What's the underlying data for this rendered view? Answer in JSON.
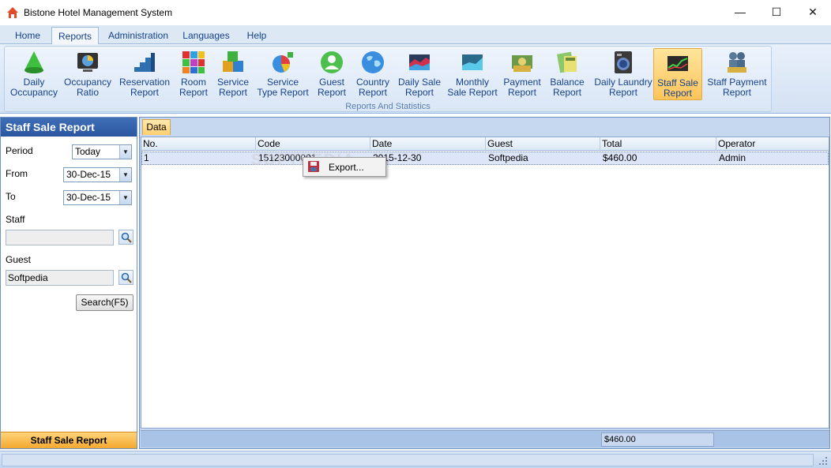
{
  "window": {
    "title": "Bistone Hotel Management System",
    "minimize": "—",
    "maximize": "☐",
    "close": "✕"
  },
  "menu": {
    "tabs": [
      "Home",
      "Reports",
      "Administration",
      "Languages",
      "Help"
    ],
    "active": "Reports"
  },
  "ribbon": {
    "group_label": "Reports And Statistics",
    "buttons": [
      {
        "line1": "Daily",
        "line2": "Occupancy",
        "icon": "cone-icon"
      },
      {
        "line1": "Occupancy",
        "line2": "Ratio",
        "icon": "pie-monitor-icon"
      },
      {
        "line1": "Reservation",
        "line2": "Report",
        "icon": "stairs-icon"
      },
      {
        "line1": "Room",
        "line2": "Report",
        "icon": "cubes-icon"
      },
      {
        "line1": "Service",
        "line2": "Report",
        "icon": "boxes-icon"
      },
      {
        "line1": "Service",
        "line2": "Type Report",
        "icon": "pie-stack-icon"
      },
      {
        "line1": "Guest",
        "line2": "Report",
        "icon": "guest-icon"
      },
      {
        "line1": "Country",
        "line2": "Report",
        "icon": "globe-icon"
      },
      {
        "line1": "Daily Sale",
        "line2": "Report",
        "icon": "area-chart-icon"
      },
      {
        "line1": "Monthly",
        "line2": "Sale Report",
        "icon": "line-chart-icon"
      },
      {
        "line1": "Payment",
        "line2": "Report",
        "icon": "money-icon"
      },
      {
        "line1": "Balance",
        "line2": "Report",
        "icon": "calculator-icon"
      },
      {
        "line1": "Daily Laundry",
        "line2": "Report",
        "icon": "washer-icon"
      },
      {
        "line1": "Staff Sale",
        "line2": "Report",
        "icon": "stock-chart-icon",
        "active": true
      },
      {
        "line1": "Staff Payment",
        "line2": "Report",
        "icon": "staff-money-icon"
      }
    ]
  },
  "left": {
    "title": "Staff Sale Report",
    "period_label": "Period",
    "period_value": "Today",
    "from_label": "From",
    "from_value": "30-Dec-15",
    "to_label": "To",
    "to_value": "30-Dec-15",
    "staff_label": "Staff",
    "staff_value": "",
    "guest_label": "Guest",
    "guest_value": "Softpedia",
    "search_label": "Search(F5)",
    "footer": "Staff Sale Report"
  },
  "grid": {
    "tab": "Data",
    "columns": [
      "No.",
      "Code",
      "Date",
      "Guest",
      "Total",
      "Operator"
    ],
    "rows": [
      {
        "no": "1",
        "code": "15123000001",
        "date": "2015-12-30",
        "guest": "Softpedia",
        "total": "$460.00",
        "operator": "Admin"
      }
    ],
    "footer_total": "$460.00"
  },
  "context_menu": {
    "export": "Export..."
  },
  "watermark": "SOFTPEDIA",
  "colors": {
    "accent": "#2a56a0",
    "highlight": "#ffc45a",
    "ribbon_text": "#15428b"
  }
}
